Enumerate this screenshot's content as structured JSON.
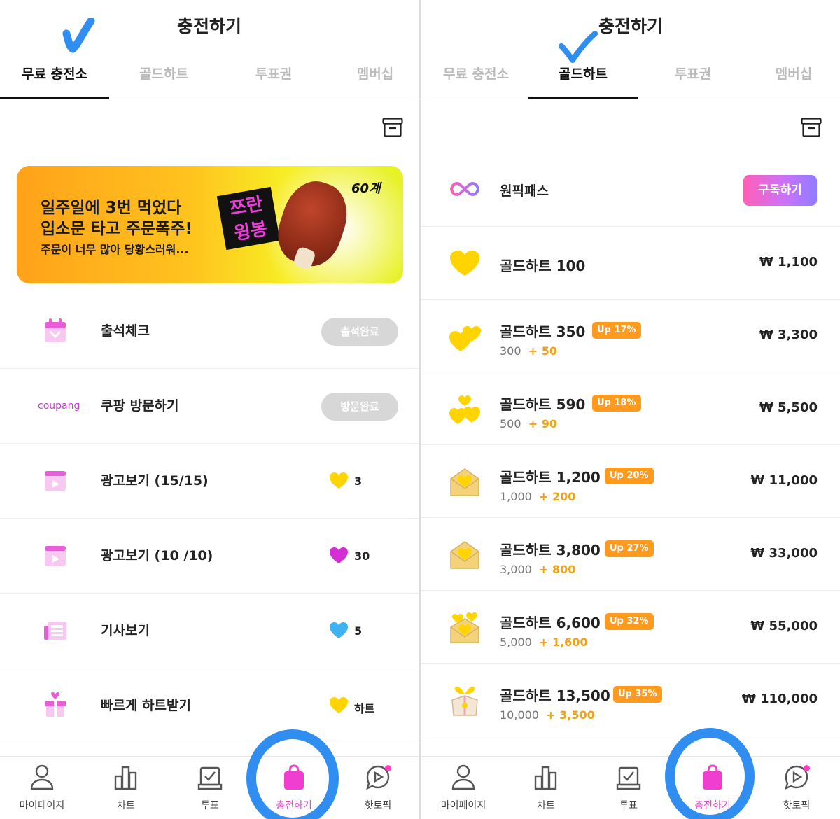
{
  "left": {
    "title": "충전하기",
    "tabs": [
      "무료 충전소",
      "골드하트",
      "투표권",
      "멤버십"
    ],
    "banner": {
      "line1": "일주일에 3번 먹었다",
      "line2": "입소문 타고 주문폭주!",
      "line3": "주문이 너무 많아 당황스러워...",
      "stamp_text": "쯔란 윙봉",
      "brand": "60계"
    },
    "rows": [
      {
        "label": "출석체크",
        "action": "출석완료",
        "icon": "calendar-icon"
      },
      {
        "label": "쿠팡 방문하기",
        "action": "방문완료",
        "logo": "coupang"
      },
      {
        "label": "광고보기 (15/15)",
        "reward": "3",
        "icon": "video-ad-icon",
        "heart_color": "#ffd400"
      },
      {
        "label": "광고보기 (10 /10)",
        "reward": "30",
        "icon": "video-ad-icon",
        "heart_color": "#d52ed6"
      },
      {
        "label": "기사보기",
        "reward": "5",
        "icon": "news-icon",
        "heart_color": "#3fb3f2"
      },
      {
        "label": "빠르게 하트받기",
        "reward": "하트",
        "icon": "gift-icon",
        "heart_color": "#ffd400"
      }
    ]
  },
  "right": {
    "title": "충전하기",
    "tabs": [
      "무료 충전소",
      "골드하트",
      "투표권",
      "멤버십"
    ],
    "onepick": {
      "label": "원픽패스",
      "button": "구독하기"
    },
    "products": [
      {
        "name": "골드하트 100",
        "price": "₩ 1,100"
      },
      {
        "name": "골드하트 350",
        "badge": "Up 17%",
        "base": "300",
        "bonus": "+ 50",
        "price": "₩ 3,300"
      },
      {
        "name": "골드하트 590",
        "badge": "Up 18%",
        "base": "500",
        "bonus": "+ 90",
        "price": "₩ 5,500"
      },
      {
        "name": "골드하트 1,200",
        "badge": "Up 20%",
        "base": "1,000",
        "bonus": "+ 200",
        "price": "₩ 11,000"
      },
      {
        "name": "골드하트 3,800",
        "badge": "Up 27%",
        "base": "3,000",
        "bonus": "+ 800",
        "price": "₩ 33,000"
      },
      {
        "name": "골드하트 6,600",
        "badge": "Up 32%",
        "base": "5,000",
        "bonus": "+ 1,600",
        "price": "₩ 55,000"
      },
      {
        "name": "골드하트 13,500",
        "badge": "Up 35%",
        "base": "10,000",
        "bonus": "+ 3,500",
        "price": "₩ 110,000"
      }
    ]
  },
  "nav": [
    "마이페이지",
    "차트",
    "투표",
    "충전하기",
    "핫토픽"
  ],
  "colors": {
    "accent_pink": "#f03ed0",
    "gold": "#ffd400",
    "badge_orange": "#ff9a1f",
    "annotation_blue": "#2f8eef"
  }
}
